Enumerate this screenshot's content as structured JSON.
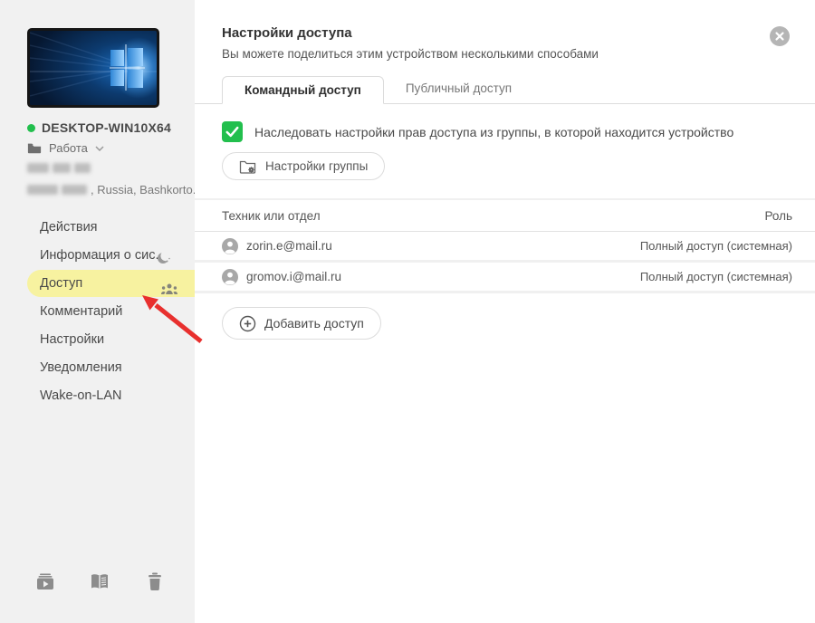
{
  "colors": {
    "accent_green": "#22bf4d",
    "highlight_yellow": "#f7f2a0",
    "arrow_red": "#e8302e",
    "sidebar_bg": "#f1f1f1",
    "border": "#dcdcdc"
  },
  "sidebar": {
    "device": {
      "name": "DESKTOP-WIN10X64",
      "group": "Работа",
      "location_visible_text": ", Russia, Bashkorto..."
    },
    "menu": [
      {
        "label": "Действия"
      },
      {
        "label": "Информация о сис...",
        "icon": "moon-icon"
      },
      {
        "label": "Доступ",
        "icon": "users-group-icon",
        "active": true
      },
      {
        "label": "Комментарий"
      },
      {
        "label": "Настройки"
      },
      {
        "label": "Уведомления"
      },
      {
        "label": "Wake-on-LAN"
      }
    ],
    "footer_icons": [
      "recordings-icon",
      "journal-icon",
      "delete-icon"
    ]
  },
  "panel": {
    "title": "Настройки доступа",
    "subtitle": "Вы можете поделиться этим устройством несколькими способами",
    "close_icon": "close-icon",
    "tabs": [
      {
        "label": "Командный доступ",
        "active": true
      },
      {
        "label": "Публичный доступ",
        "active": false
      }
    ],
    "inherit_checkbox": {
      "checked": true,
      "label": "Наследовать настройки прав доступа из группы, в которой находится устройство"
    },
    "group_settings_button": "Настройки группы",
    "table": {
      "columns": {
        "user": "Техник или отдел",
        "role": "Роль"
      },
      "rows": [
        {
          "user": "zorin.e@mail.ru",
          "role": "Полный доступ (системная)"
        },
        {
          "user": "gromov.i@mail.ru",
          "role": "Полный доступ (системная)"
        }
      ]
    },
    "add_button": "Добавить доступ"
  }
}
